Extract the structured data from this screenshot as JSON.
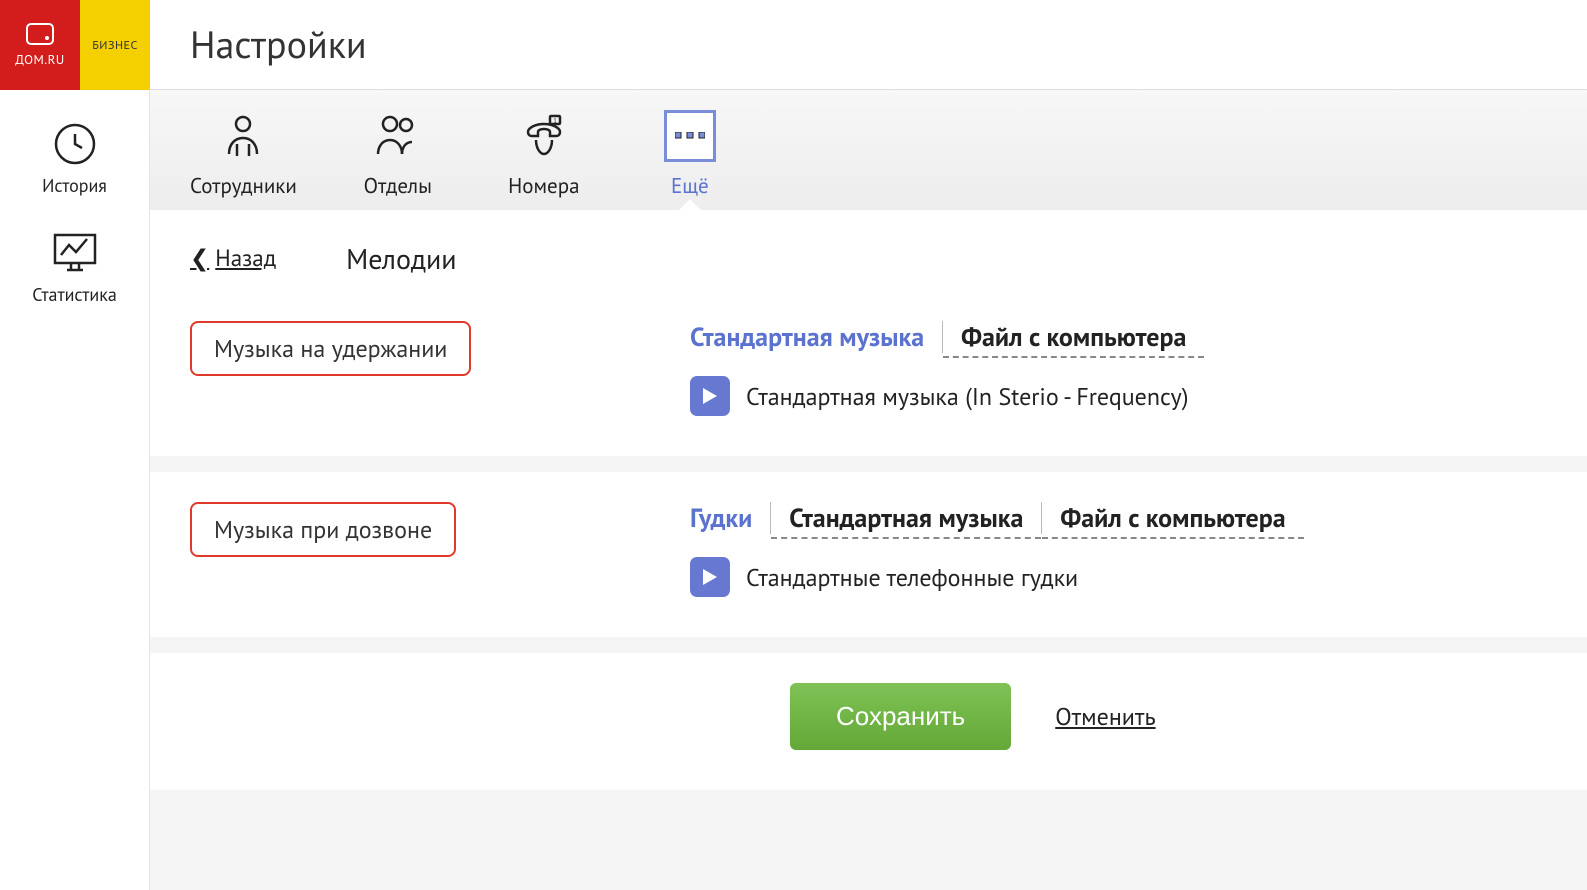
{
  "logo": {
    "main": "ДОМ",
    "suffix": ".RU",
    "biz": "БИЗНЕС"
  },
  "header": {
    "title": "Настройки"
  },
  "sidebar": {
    "items": [
      {
        "label": "История"
      },
      {
        "label": "Статистика"
      }
    ]
  },
  "tabs": [
    {
      "label": "Сотрудники"
    },
    {
      "label": "Отделы"
    },
    {
      "label": "Номера"
    },
    {
      "label": "Ещё"
    }
  ],
  "page": {
    "back": "Назад",
    "title": "Мелодии"
  },
  "hold": {
    "label": "Музыка на удержании",
    "options": [
      {
        "label": "Стандартная музыка",
        "active": true
      },
      {
        "label": "Файл с компьютера",
        "active": false
      }
    ],
    "track": "Стандартная музыка (In Sterio - Frequency)"
  },
  "ring": {
    "label": "Музыка при дозвоне",
    "options": [
      {
        "label": "Гудки",
        "active": true
      },
      {
        "label": "Стандартная музыка",
        "active": false
      },
      {
        "label": "Файл с компьютера",
        "active": false
      }
    ],
    "track": "Стандартные телефонные гудки"
  },
  "buttons": {
    "save": "Сохранить",
    "cancel": "Отменить"
  }
}
